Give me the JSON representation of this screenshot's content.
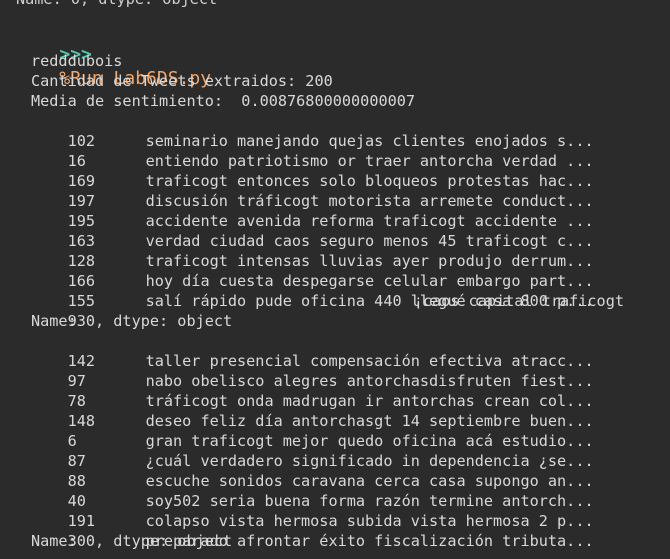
{
  "console": {
    "previous_output_line": "Name: 0, dtype: object",
    "prompt_marker": ">>>",
    "command": "%Run Lab6DS.py",
    "username": "redddubois",
    "tweet_count_line": "Cantidad de Tweets extraidos: 200",
    "sentiment_line": "Media de sentimiento:  0.00876800000000007",
    "series_footer": "Name: 0, dtype: object",
    "first_series": [
      {
        "index": "102",
        "text": "seminario manejando quejas clientes enojados s..."
      },
      {
        "index": "16",
        "text": "entiendo patriotismo or traer antorcha verdad ..."
      },
      {
        "index": "169",
        "text": "traficogt entonces solo bloqueos protestas hac..."
      },
      {
        "index": "197",
        "text": "discusión tráficogt motorista arremete conduct..."
      },
      {
        "index": "195",
        "text": "accidente avenida reforma traficogt accidente ..."
      },
      {
        "index": "163",
        "text": "verdad ciudad caos seguro menos 45 traficogt c..."
      },
      {
        "index": "128",
        "text": "traficogt intensas lluvias ayer produjo derrum..."
      },
      {
        "index": "166",
        "text": "hoy día cuesta despegarse celular embargo part..."
      },
      {
        "index": "155",
        "text": "salí rápido pude oficina 440 llegué casa 800 p..."
      },
      {
        "index": "93",
        "text": "¡caos capital traficogt"
      }
    ],
    "second_series": [
      {
        "index": "142",
        "text": "taller presencial compensación efectiva atracc..."
      },
      {
        "index": "97",
        "text": "nabo obelisco alegres antorchasdisfruten fiest..."
      },
      {
        "index": "78",
        "text": "tráficogt onda madrugan ir antorchas crean col..."
      },
      {
        "index": "148",
        "text": "deseo feliz día antorchasgt 14 septiembre buen..."
      },
      {
        "index": "6",
        "text": "gran traficogt mejor quedo oficina acá estudio..."
      },
      {
        "index": "87",
        "text": "¿cuál verdadero significado in dependencia ¿se..."
      },
      {
        "index": "88",
        "text": "escuche sonidos caravana cerca casa supongo an..."
      },
      {
        "index": "40",
        "text": "soy502 seria buena forma razón termine antorch..."
      },
      {
        "index": "191",
        "text": "colapso vista hermosa subida vista hermosa 2 p..."
      },
      {
        "index": "30",
        "text": "preparado afrontar éxito fiscalización tributa..."
      }
    ]
  }
}
